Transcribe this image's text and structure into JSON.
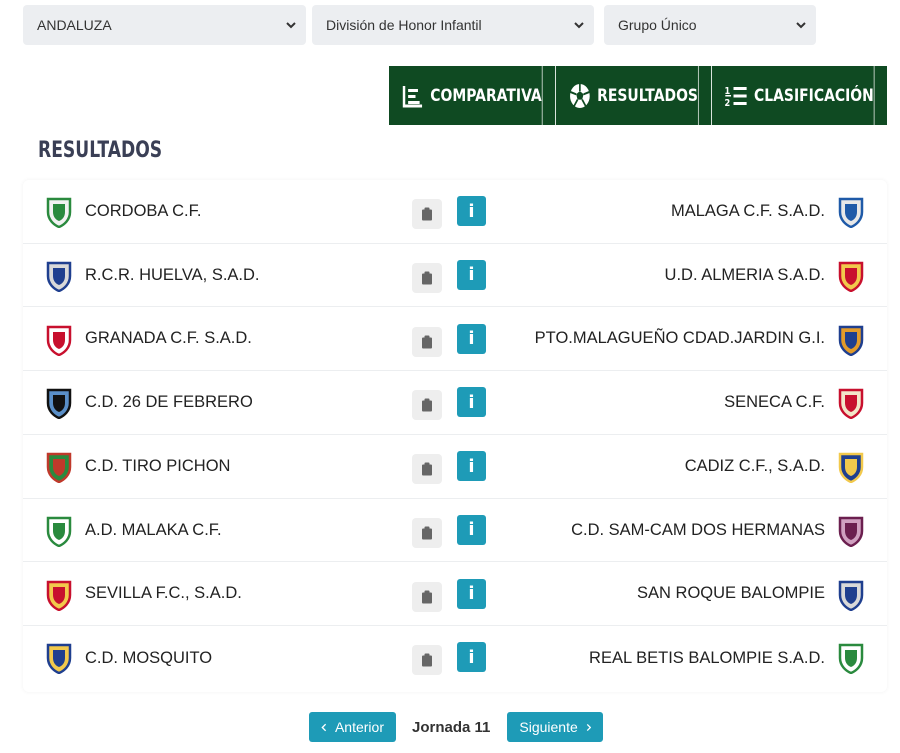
{
  "filters": {
    "region": "ANDALUZA",
    "division": "División de Honor Infantil",
    "group": "Grupo Único"
  },
  "tabs": [
    {
      "label": "COMPARATIVA",
      "icon": "chart-list-icon"
    },
    {
      "label": "RESULTADOS",
      "icon": "soccer-ball-icon"
    },
    {
      "label": "CLASIFICACIÓN",
      "icon": "ranking-list-icon"
    }
  ],
  "section_title": "RESULTADOS",
  "matches": [
    {
      "home": "CORDOBA C.F.",
      "away": "MALAGA C.F. S.A.D."
    },
    {
      "home": "R.C.R. HUELVA, S.A.D.",
      "away": "U.D. ALMERIA S.A.D."
    },
    {
      "home": "GRANADA C.F. S.A.D.",
      "away": "PTO.MALAGUEÑO CDAD.JARDIN G.I."
    },
    {
      "home": "C.D. 26 DE FEBRERO",
      "away": "SENECA C.F."
    },
    {
      "home": "C.D. TIRO PICHON",
      "away": "CADIZ C.F., S.A.D."
    },
    {
      "home": "A.D. MALAKA C.F.",
      "away": "C.D. SAM-CAM DOS HERMANAS"
    },
    {
      "home": "SEVILLA F.C., S.A.D.",
      "away": "SAN ROQUE BALOMPIE"
    },
    {
      "home": "C.D. MOSQUITO",
      "away": "REAL BETIS BALOMPIE S.A.D."
    }
  ],
  "info_label": "i",
  "pager": {
    "prev": "Anterior",
    "current": "Jornada 11",
    "next": "Siguiente"
  },
  "colors": {
    "tab_bg": "#0f4a22",
    "accent": "#1e9bb7",
    "select_bg": "#eceef1"
  }
}
